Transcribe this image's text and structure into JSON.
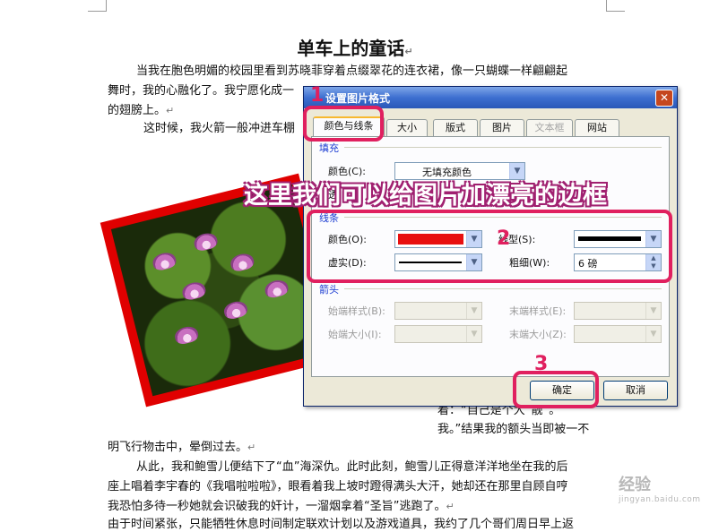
{
  "document": {
    "title": "单车上的童话",
    "lines": [
      "当我在胞色明媚的校园里看到苏晓菲穿着点缀翠花的连衣裙，像一只蝴蝶一样翩翩起",
      "舞时，我的心融化了。我宁愿化成一",
      "的翅膀上。",
      "这时候，我火箭一般冲进车棚",
      "着：“自己是个大“靓”。",
      "我。”结果我的额头当即被一不",
      "明飞行物击中，晕倒过去。",
      "从此，我和鲍雪儿便结下了“血”海深仇。此时此刻，鲍雪儿正得意洋洋地坐在我的后",
      "座上唱着李宇春的《我唱啦啦啦》，眼看着我上坡时蹬得满头大汗，她却还在那里自顾自哼",
      "我恐怕多待一秒她就会识破我的奸计，一溜烟拿着“圣旨”逃跑了。",
      "由于时间紧张，只能牺牲休息时间制定联欢计划以及游戏道具，我约了几个哥们周日早上返"
    ],
    "para_mark": "↵"
  },
  "dialog": {
    "title": "设置图片格式",
    "close": "✕",
    "tabs": [
      {
        "label": "颜色与线条",
        "state": "active"
      },
      {
        "label": "大小",
        "state": "normal"
      },
      {
        "label": "版式",
        "state": "normal"
      },
      {
        "label": "图片",
        "state": "normal"
      },
      {
        "label": "文本框",
        "state": "disabled"
      },
      {
        "label": "网站",
        "state": "normal"
      }
    ],
    "fill_group": "填充",
    "fill_color_label": "颜色(C):",
    "fill_color_value": "无填充颜色",
    "fill_transparency_label": "透",
    "line_group": "线条",
    "line_color_label": "颜色(O):",
    "line_color": "#e81010",
    "line_type_label": "线型(S):",
    "dash_label": "虚实(D):",
    "weight_label": "粗细(W):",
    "weight_value": "6 磅",
    "arrows_group": "箭头",
    "begin_style_label": "始端样式(B):",
    "end_style_label": "末端样式(E):",
    "begin_size_label": "始端大小(I):",
    "end_size_label": "末端大小(Z):",
    "ok": "确定",
    "cancel": "取消"
  },
  "annotations": {
    "banner": "这里我们可以给图片加漂亮的边框",
    "n1": "1",
    "n2": "2",
    "n3": "3",
    "accent": "#e0205f"
  },
  "watermark": {
    "text": "经验",
    "sub": "jingyan.baidu.com"
  }
}
